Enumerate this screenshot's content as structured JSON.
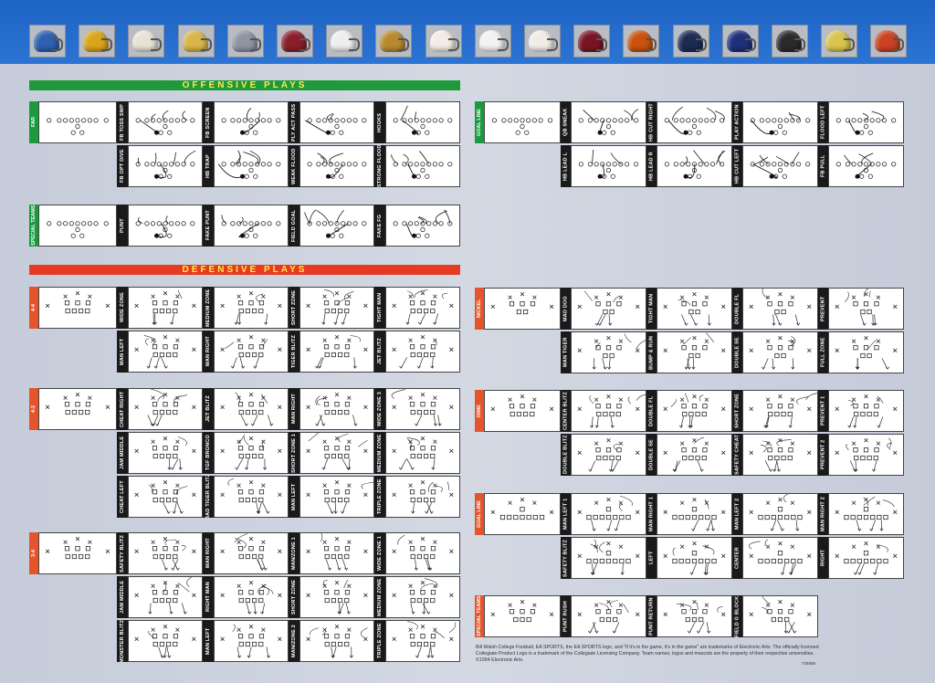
{
  "banner": {
    "helmets": [
      {
        "icon": "football-helmet-icon",
        "color": "#2f5fb0"
      },
      {
        "icon": "football-helmet-icon",
        "color": "#d9a51c"
      },
      {
        "icon": "football-helmet-icon",
        "color": "#e8e2d6"
      },
      {
        "icon": "football-helmet-icon",
        "color": "#d8b64a"
      },
      {
        "icon": "football-helmet-icon",
        "color": "#8e95a3"
      },
      {
        "icon": "football-helmet-icon",
        "color": "#8a1f2a"
      },
      {
        "icon": "football-helmet-icon",
        "color": "#eeeeee"
      },
      {
        "icon": "football-helmet-icon",
        "color": "#b88a30"
      },
      {
        "icon": "football-helmet-icon",
        "color": "#f1ece4"
      },
      {
        "icon": "football-helmet-icon",
        "color": "#f2f2f2"
      },
      {
        "icon": "football-helmet-icon",
        "color": "#f0ede6"
      },
      {
        "icon": "football-helmet-icon",
        "color": "#7a1424"
      },
      {
        "icon": "football-helmet-icon",
        "color": "#c9520f"
      },
      {
        "icon": "football-helmet-icon",
        "color": "#1c2b52"
      },
      {
        "icon": "football-helmet-icon",
        "color": "#1f2f7a"
      },
      {
        "icon": "football-helmet-icon",
        "color": "#2a2a2a"
      },
      {
        "icon": "football-helmet-icon",
        "color": "#d7c54f"
      },
      {
        "icon": "football-helmet-icon",
        "color": "#c94222"
      }
    ]
  },
  "colors": {
    "offense_bar": "#1f9a3a",
    "defense_bar": "#e63b22",
    "form_green": "#1b9a3e",
    "form_red": "#e5542a"
  },
  "offense": {
    "title": "OFFENSIVE PLAYS",
    "far": {
      "formation": "FAR",
      "row1": [
        "FB TOSS SWP",
        "FB SCREEN",
        "PLY ACT PASS",
        "HOOKS"
      ],
      "row2": [
        "FB OPT DIVE",
        "HB TRAP",
        "WEAK FLOOD",
        "STRONG FLOOD"
      ]
    },
    "special": {
      "formation": "SPECIAL TEAMS",
      "row1": [
        "PUNT",
        "FAKE PUNT",
        "FIELD GOAL",
        "FAKE FG"
      ]
    },
    "goal_line": {
      "formation": "GOAL LINE",
      "row1": [
        "QB SNEAK",
        "HB CUT RIGHT",
        "PLAY ACTION",
        "FLOOD LEFT"
      ],
      "row2": [
        "HB LEAD L",
        "HB LEAD R",
        "HB CUT LEFT",
        "FB PULL"
      ]
    }
  },
  "defense": {
    "title": "DEFENSIVE PLAYS",
    "d44": {
      "formation": "4-4",
      "row1": [
        "WIDE ZONE",
        "MEDIUM ZONE",
        "SHORT ZONE",
        "TIGHT MAN"
      ],
      "row2": [
        "MAN LEFT",
        "MAN RIGHT",
        "TIGER BLITZ",
        "JET BLITZ"
      ]
    },
    "d43": {
      "formation": "4-3",
      "row1": [
        "CHEAT RIGHT",
        "JET BLITZ",
        "MAN RIGHT",
        "WIDE ZONE 3"
      ],
      "row2": [
        "JAM MIDDLE",
        "TGF BRONCO",
        "SHORT ZONE 1",
        "MEDIUM ZONE"
      ],
      "row3": [
        "CHEAT LEFT",
        "BAD TIGER BLITZ",
        "MAN LEFT",
        "TRIPLE ZONE"
      ]
    },
    "d34": {
      "formation": "3-4",
      "row1": [
        "SAFETY BLITZ",
        "MAN RIGHT",
        "MAN/ZONE 1",
        "WIDE ZONE 1"
      ],
      "row2": [
        "JAM MIDDLE",
        "RIGHT MAN",
        "SHORT ZONE",
        "MEDIUM ZONE"
      ],
      "row3": [
        "MONSTER BLITZ",
        "MAN LEFT",
        "MAN/ZONE 2",
        "TRIPLE ZONE"
      ]
    },
    "nickel": {
      "formation": "NICKEL",
      "row1": [
        "MAD DOG",
        "TIGHT MAN",
        "DOUBLE FL",
        "PREVENT"
      ],
      "row2": [
        "MAN TIGER",
        "BUMP & RUN",
        "DOUBLE SE",
        "FULL ZONE"
      ]
    },
    "dime": {
      "formation": "DIME",
      "row1": [
        "CENTER BLITZ",
        "DOUBLE FL",
        "SHORT ZONE",
        "PREVENT 1"
      ],
      "row2": [
        "DOUBLE BLITZ",
        "DOUBLE SE",
        "SAFETY CHEAT",
        "PREVENT 2"
      ]
    },
    "goal_line": {
      "formation": "GOAL LINE",
      "row1": [
        "MAN LEFT 1",
        "MAN RIGHT 1",
        "MAN LEFT 2",
        "MAN RIGHT 2"
      ],
      "row2": [
        "SAFETY BLITZ",
        "LEFT",
        "CENTER",
        "RIGHT"
      ]
    },
    "special": {
      "formation": "SPECIAL TEAMS",
      "row1": [
        "PUNT RUSH",
        "PUNT RETURN",
        "FIELD G BLOCK"
      ]
    }
  },
  "legal": "Bill Walsh College Football, EA SPORTS, the EA SPORTS logo, and \"If it's in the game, it's in the game\" are trademarks of Electronic Arts. The officially licensed Collegiate Product Logo is a trademark of the Collegiate Licensing Company. Team names, logos and mascots are the property of their respective universities. ©1994 Electronic Arts.",
  "code": "734869"
}
